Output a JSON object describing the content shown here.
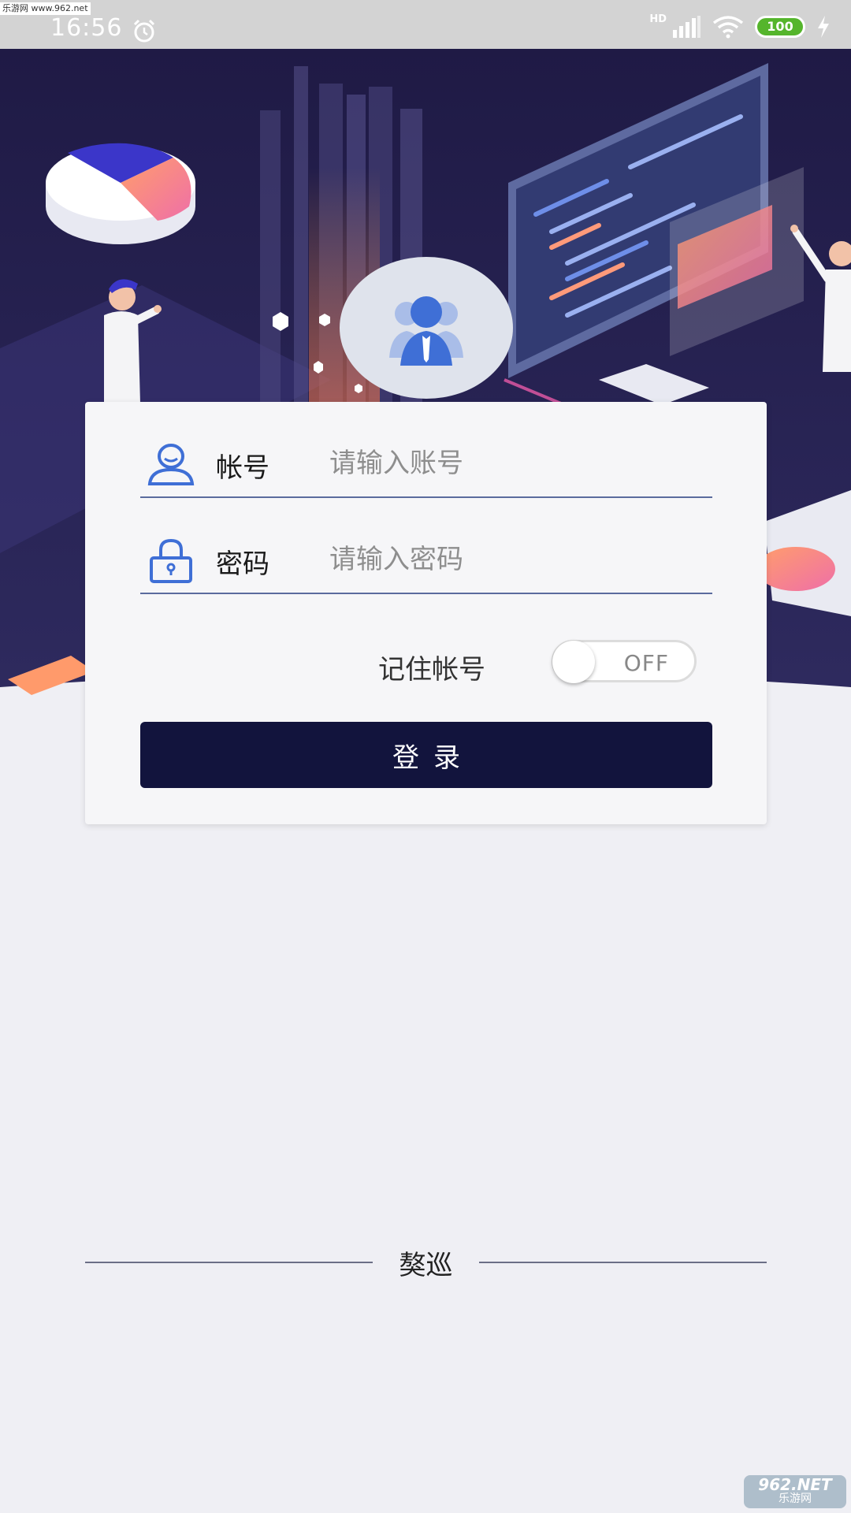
{
  "statusbar": {
    "watermark": "乐游网 www.962.net",
    "time": "16:56",
    "hd": "HD",
    "battery": "100"
  },
  "login": {
    "account_label": "帐号",
    "account_placeholder": "请输入账号",
    "password_label": "密码",
    "password_placeholder": "请输入密码",
    "remember_label": "记住帐号",
    "remember_state": "OFF",
    "submit_label": "登录"
  },
  "footer": {
    "brand": "獒巡"
  },
  "watermark_br": {
    "main": "962.NET",
    "sub": "乐游网"
  },
  "colors": {
    "primary": "#12143d",
    "icon_blue": "#3f6fd6",
    "background": "#efeff4"
  }
}
